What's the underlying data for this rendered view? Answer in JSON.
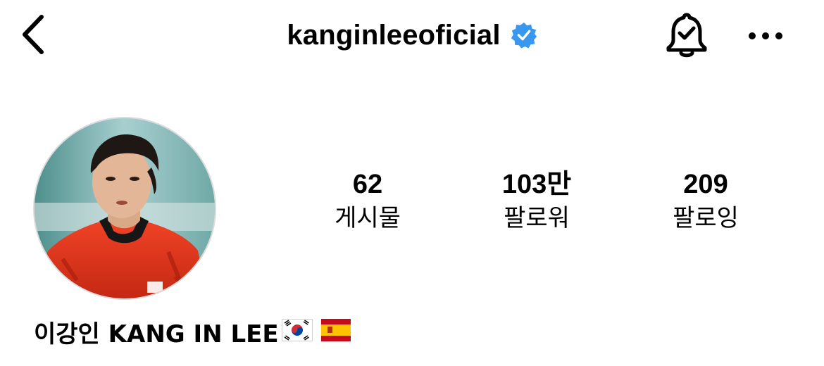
{
  "header": {
    "back_icon": "chevron-left-icon",
    "username": "kanginleeoficial",
    "verified_icon": "verified-badge-icon",
    "verified_color": "#3897f0",
    "notifications_icon": "bell-check-icon",
    "more_icon": "ellipsis-icon"
  },
  "profile": {
    "avatar_alt": "profile-photo",
    "stats": [
      {
        "value": "62",
        "label": "게시물"
      },
      {
        "value": "103만",
        "label": "팔로워"
      },
      {
        "value": "209",
        "label": "팔로잉"
      }
    ],
    "full_name": "이강인 KANG IN LEE",
    "name_flags": [
      "south-korea-flag-icon",
      "spain-flag-icon"
    ]
  }
}
